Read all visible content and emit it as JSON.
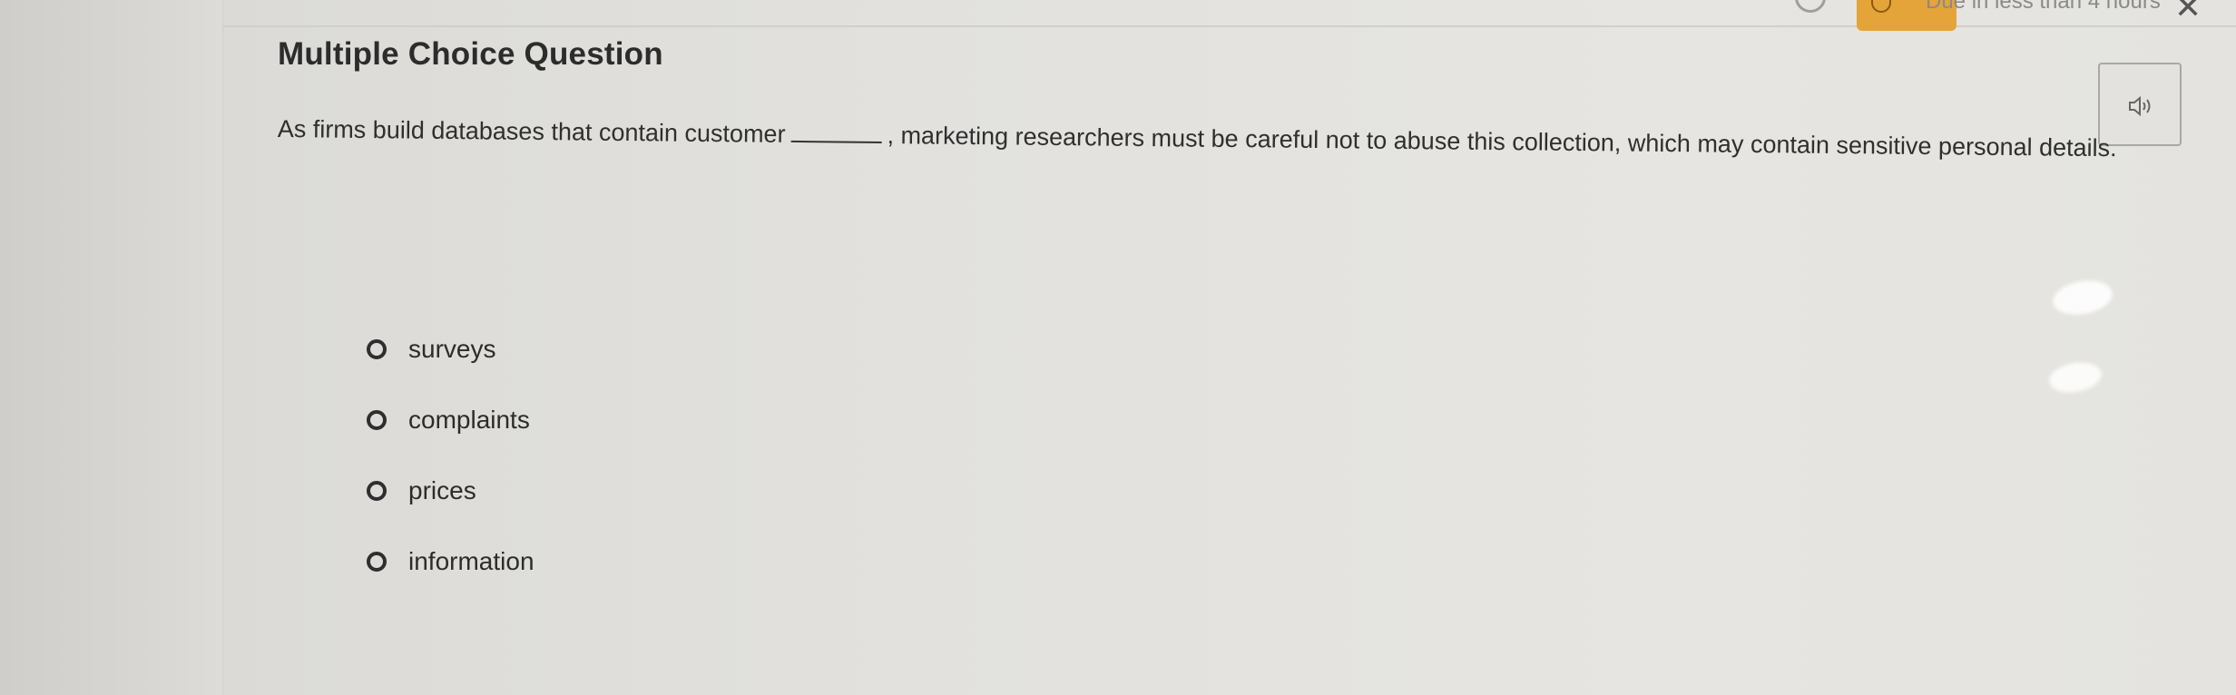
{
  "header": {
    "due_text": "Due in less than 4 hours",
    "close_symbol": "✕",
    "warning_color": "#e4a43a"
  },
  "question": {
    "type_title": "Multiple Choice Question",
    "text_before": "As firms build databases that contain customer",
    "text_after": ", marketing researchers must be careful not to abuse this collection, which may contain sensitive personal details."
  },
  "audio": {
    "icon": "speaker-icon"
  },
  "options": [
    {
      "label": "surveys"
    },
    {
      "label": "complaints"
    },
    {
      "label": "prices"
    },
    {
      "label": "information"
    }
  ]
}
